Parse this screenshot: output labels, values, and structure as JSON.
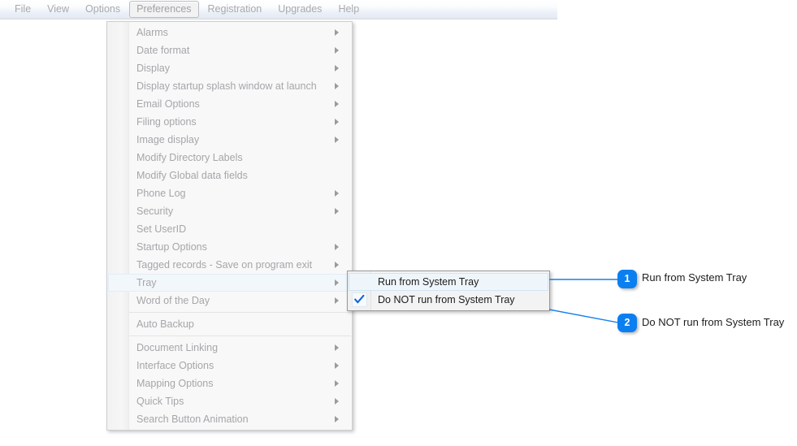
{
  "menubar": {
    "items": [
      {
        "label": "File",
        "active": false
      },
      {
        "label": "View",
        "active": false
      },
      {
        "label": "Options",
        "active": false
      },
      {
        "label": "Preferences",
        "active": true
      },
      {
        "label": "Registration",
        "active": false
      },
      {
        "label": "Upgrades",
        "active": false
      },
      {
        "label": "Help",
        "active": false
      }
    ]
  },
  "preferences_menu": {
    "items": [
      {
        "label": "Alarms",
        "submenu": true,
        "selected": false,
        "separator_after": false
      },
      {
        "label": "Date format",
        "submenu": true,
        "selected": false,
        "separator_after": false
      },
      {
        "label": "Display",
        "submenu": true,
        "selected": false,
        "separator_after": false
      },
      {
        "label": "Display startup splash window at launch",
        "submenu": true,
        "selected": false,
        "separator_after": false
      },
      {
        "label": "Email Options",
        "submenu": true,
        "selected": false,
        "separator_after": false
      },
      {
        "label": "Filing options",
        "submenu": true,
        "selected": false,
        "separator_after": false
      },
      {
        "label": "Image display",
        "submenu": true,
        "selected": false,
        "separator_after": false
      },
      {
        "label": "Modify Directory Labels",
        "submenu": false,
        "selected": false,
        "separator_after": false
      },
      {
        "label": "Modify Global data fields",
        "submenu": false,
        "selected": false,
        "separator_after": false
      },
      {
        "label": "Phone Log",
        "submenu": true,
        "selected": false,
        "separator_after": false
      },
      {
        "label": "Security",
        "submenu": true,
        "selected": false,
        "separator_after": false
      },
      {
        "label": "Set UserID",
        "submenu": false,
        "selected": false,
        "separator_after": false
      },
      {
        "label": "Startup Options",
        "submenu": true,
        "selected": false,
        "separator_after": false
      },
      {
        "label": "Tagged records - Save on program exit",
        "submenu": true,
        "selected": false,
        "separator_after": false
      },
      {
        "label": "Tray",
        "submenu": true,
        "selected": true,
        "separator_after": false
      },
      {
        "label": "Word of the Day",
        "submenu": true,
        "selected": false,
        "separator_after": true
      },
      {
        "label": "Auto Backup",
        "submenu": false,
        "selected": false,
        "separator_after": true
      },
      {
        "label": "Document Linking",
        "submenu": true,
        "selected": false,
        "separator_after": false
      },
      {
        "label": "Interface Options",
        "submenu": true,
        "selected": false,
        "separator_after": false
      },
      {
        "label": "Mapping Options",
        "submenu": true,
        "selected": false,
        "separator_after": false
      },
      {
        "label": "Quick Tips",
        "submenu": true,
        "selected": false,
        "separator_after": false
      },
      {
        "label": "Search Button Animation",
        "submenu": true,
        "selected": false,
        "separator_after": false
      }
    ]
  },
  "tray_submenu": {
    "items": [
      {
        "label": "Run from System Tray",
        "checked": false,
        "hovered": true
      },
      {
        "label": "Do NOT run from System Tray",
        "checked": true,
        "hovered": false
      }
    ]
  },
  "callouts": [
    {
      "number": "1",
      "text": "Run from System Tray"
    },
    {
      "number": "2",
      "text": "Do NOT run from System Tray"
    }
  ],
  "colors": {
    "accent": "#0b7ff0",
    "menu_text": "#a6a6ab",
    "submenu_text": "#1b1b1b",
    "check_mark": "#1565d8",
    "connector": "#1580e8"
  }
}
